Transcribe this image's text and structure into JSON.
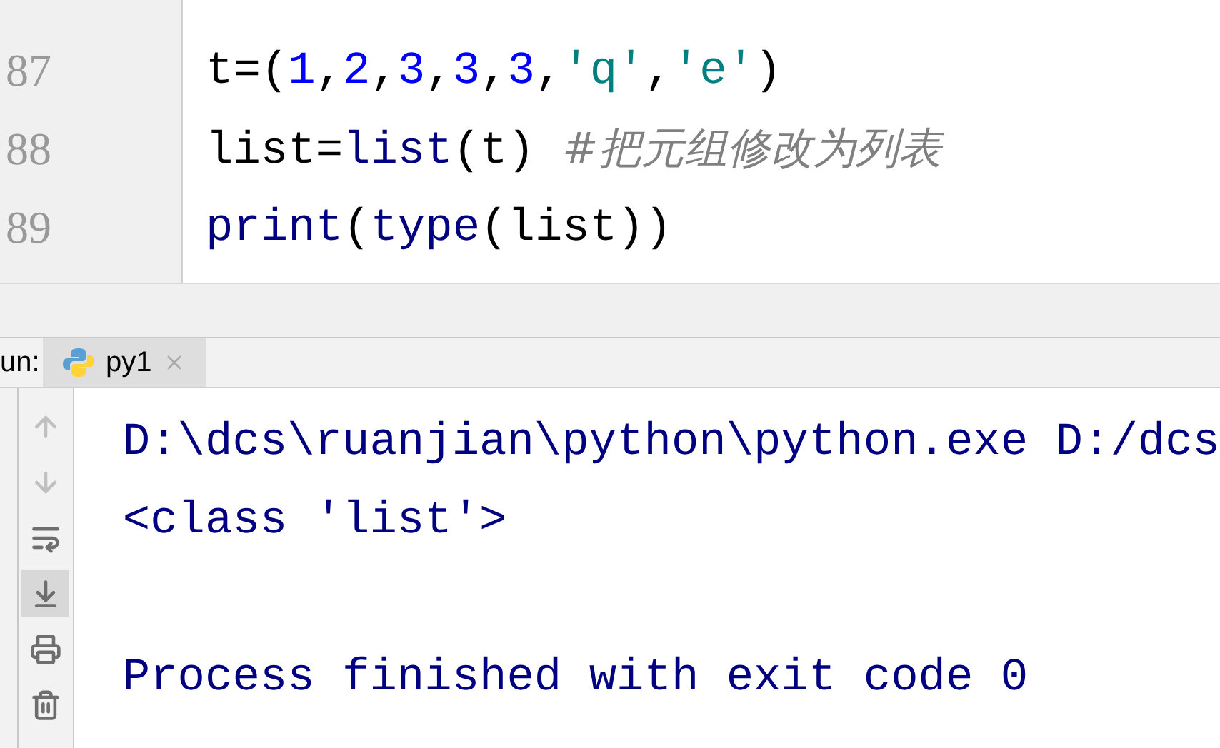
{
  "editor": {
    "lines": [
      {
        "number": "87",
        "tokens": [
          {
            "text": "t=(",
            "kind": "plain"
          },
          {
            "text": "1",
            "kind": "number"
          },
          {
            "text": ",",
            "kind": "plain"
          },
          {
            "text": "2",
            "kind": "number"
          },
          {
            "text": ",",
            "kind": "plain"
          },
          {
            "text": "3",
            "kind": "number"
          },
          {
            "text": ",",
            "kind": "plain"
          },
          {
            "text": "3",
            "kind": "number"
          },
          {
            "text": ",",
            "kind": "plain"
          },
          {
            "text": "3",
            "kind": "number"
          },
          {
            "text": ",",
            "kind": "plain"
          },
          {
            "text": "'q'",
            "kind": "string"
          },
          {
            "text": ",",
            "kind": "plain"
          },
          {
            "text": "'e'",
            "kind": "string"
          },
          {
            "text": ")",
            "kind": "plain"
          }
        ]
      },
      {
        "number": "88",
        "tokens": [
          {
            "text": "list=",
            "kind": "plain"
          },
          {
            "text": "list",
            "kind": "builtin"
          },
          {
            "text": "(t) ",
            "kind": "plain"
          },
          {
            "text": "#把元组修改为列表",
            "kind": "comment"
          }
        ]
      },
      {
        "number": "89",
        "tokens": [
          {
            "text": "print",
            "kind": "builtin"
          },
          {
            "text": "(",
            "kind": "plain"
          },
          {
            "text": "type",
            "kind": "builtin"
          },
          {
            "text": "(list))",
            "kind": "plain"
          }
        ]
      }
    ]
  },
  "run_panel": {
    "label": "un:",
    "tabs": [
      {
        "label": "py1",
        "selected": true
      }
    ],
    "tools": [
      {
        "kind": "up",
        "disabled": true,
        "selected": false
      },
      {
        "kind": "down",
        "disabled": true,
        "selected": false
      },
      {
        "kind": "wrap",
        "disabled": false,
        "selected": false
      },
      {
        "kind": "scroll-end",
        "disabled": false,
        "selected": true
      },
      {
        "kind": "print",
        "disabled": false,
        "selected": false
      },
      {
        "kind": "trash",
        "disabled": false,
        "selected": false
      }
    ],
    "console_blocks": [
      {
        "lines": [
          "D:\\dcs\\ruanjian\\python\\python.exe D:/dcs",
          "<class 'list'>"
        ]
      },
      {
        "lines": [
          "Process finished with exit code 0"
        ]
      }
    ]
  }
}
